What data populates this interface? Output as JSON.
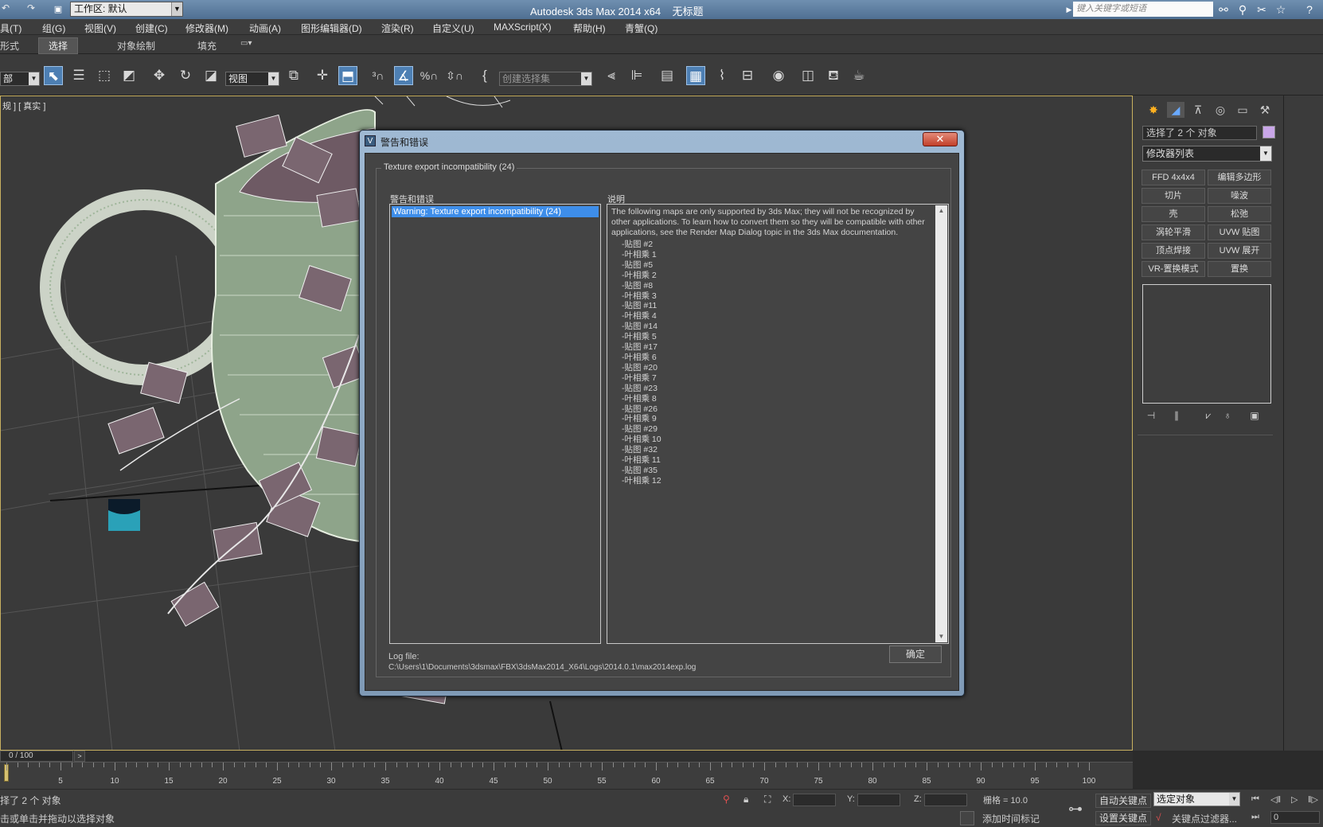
{
  "titlebar": {
    "undo_label": "↶",
    "redo_label": "↷",
    "workspace_value": "工作区: 默认",
    "app_title": "Autodesk 3ds Max  2014 x64",
    "doc_title": "无标题",
    "search_placeholder": "键入关键字或短语"
  },
  "menu": [
    "具(T)",
    "组(G)",
    "视图(V)",
    "创建(C)",
    "修改器(M)",
    "动画(A)",
    "图形编辑器(D)",
    "渲染(R)",
    "自定义(U)",
    "MAXScript(X)",
    "帮助(H)",
    "青蟹(Q)"
  ],
  "ribbon": {
    "tabs": [
      "形式",
      "选择",
      "对象绘制",
      "填充"
    ],
    "active_index": 1
  },
  "toolbar": {
    "filter_value": "部",
    "refcoord_value": "视图",
    "named_selection_placeholder": "创建选择集"
  },
  "viewport": {
    "label": "规 ] [ 真实 ]"
  },
  "dialog": {
    "title": "警告和错误",
    "close_label": "✕",
    "group_title": "Texture export incompatibility (24)",
    "list_label": "警告和错误",
    "list_items": [
      "Warning: Texture export incompatibility (24)"
    ],
    "desc_label": "说明",
    "desc_text": "The following maps are only supported by 3ds Max; they will not be recognized by other applications. To learn how to convert them so they will be compatible with other applications, see the Render Map Dialog topic in the 3ds Max documentation.",
    "desc_items": [
      "-贴图 #2",
      "-叶相乘 1",
      "-贴图 #5",
      "-叶相乘 2",
      "-贴图 #8",
      "-叶相乘 3",
      "-贴图 #11",
      "-叶相乘 4",
      "-贴图 #14",
      "-叶相乘 5",
      "-贴图 #17",
      "-叶相乘 6",
      "-贴图 #20",
      "-叶相乘 7",
      "-贴图 #23",
      "-叶相乘 8",
      "-贴图 #26",
      "-叶相乘 9",
      "-贴图 #29",
      "-叶相乘 10",
      "-贴图 #32",
      "-叶相乘 11",
      "-贴图 #35",
      "-叶相乘 12"
    ],
    "log_label": "Log file:",
    "log_path": "C:\\Users\\1\\Documents\\3dsmax\\FBX\\3dsMax2014_X64\\Logs\\2014.0.1\\max2014exp.log",
    "ok_label": "确定"
  },
  "command_panel": {
    "selection_text": "选择了 2 个 对象",
    "selection_color": "#c9a6e8",
    "modifier_list": "修改器列表",
    "modifier_buttons": [
      "FFD 4x4x4",
      "编辑多边形",
      "切片",
      "噪波",
      "壳",
      "松弛",
      "涡轮平滑",
      "UVW 贴图",
      "顶点焊接",
      "UVW 展开",
      "VR-置换模式",
      "置换"
    ]
  },
  "timeline": {
    "frame_display": "0 / 100",
    "next_label": ">",
    "ticks": [
      5,
      10,
      15,
      20,
      25,
      30,
      35,
      40,
      45,
      50,
      55,
      60,
      65,
      70,
      75,
      80,
      85,
      90,
      95,
      100
    ]
  },
  "status": {
    "selected_text": "择了 2 个 对象",
    "prompt_text": "击或单击并拖动以选择对象",
    "x_label": "X:",
    "y_label": "Y:",
    "z_label": "Z:",
    "grid_text": "栅格 = 10.0",
    "add_time_tag": "添加时间标记",
    "auto_key": "自动关键点",
    "set_key": "设置关键点",
    "selected_object": "选定对象",
    "key_filters": "关键点过滤器...",
    "frame_value": "0"
  },
  "colors": {
    "accent": "#3e8eea",
    "viewport_border": "#c8b060",
    "titlebar": "#5f7fa3"
  }
}
